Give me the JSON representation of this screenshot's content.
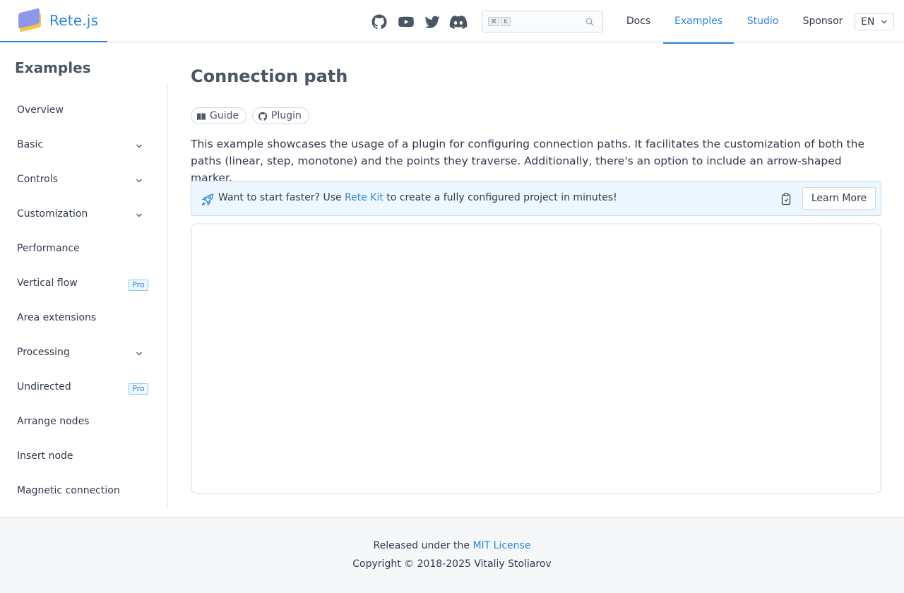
{
  "header": {
    "brand": "Rete.js",
    "social_icons": [
      "github-icon",
      "youtube-icon",
      "twitter-icon",
      "discord-icon"
    ],
    "search": {
      "key1": "⌘",
      "key2": "K",
      "placeholder": ""
    },
    "nav": {
      "docs": "Docs",
      "examples": "Examples",
      "studio": "Studio",
      "sponsor": "Sponsor"
    },
    "lang": "EN"
  },
  "sidebar": {
    "title": "Examples",
    "items": [
      {
        "label": "Overview"
      },
      {
        "label": "Basic"
      },
      {
        "label": "Controls"
      },
      {
        "label": "Customization"
      },
      {
        "label": "Performance"
      },
      {
        "label": "Vertical flow",
        "badge": "Pro"
      },
      {
        "label": "Area extensions"
      },
      {
        "label": "Processing"
      },
      {
        "label": "Undirected",
        "badge": "Pro"
      },
      {
        "label": "Arrange nodes"
      },
      {
        "label": "Insert node"
      },
      {
        "label": "Magnetic connection"
      }
    ]
  },
  "main": {
    "title": "Connection path",
    "tags": {
      "guide": "Guide",
      "plugin": "Plugin"
    },
    "description": "This example showcases the usage of a plugin for configuring connection paths. It facilitates the customization of both the paths (linear, step, monotone) and the points they traverse. Additionally, there's an option to include an arrow-shaped marker.",
    "banner": {
      "text_before": "Want to start faster? Use ",
      "link": "Rete Kit",
      "text_after": " to create a fully configured project in minutes!",
      "button": "Learn More"
    }
  },
  "footer": {
    "released_prefix": "Released under the ",
    "license": "MIT License",
    "copyright": "Copyright © 2018-2025 Vitaliy Stoliarov"
  },
  "colors": {
    "accent": "#2c86d8",
    "text": "#303a4c",
    "border": "#dcdfe6",
    "banner_bg": "#eef7fd"
  }
}
